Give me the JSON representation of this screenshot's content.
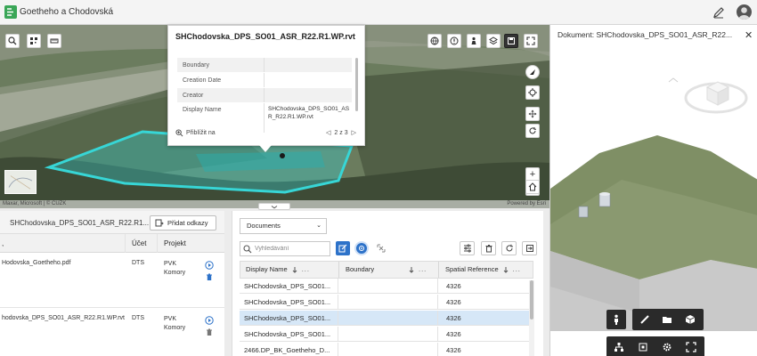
{
  "header": {
    "title": "Goetheho a Chodovská",
    "logo_icon": "app-logo-icon",
    "edit_icon": "pencil-icon",
    "avatar_icon": "user-avatar-icon"
  },
  "map": {
    "attribution_left": "Maxar, Microsoft | © ČÚZK",
    "attribution_right": "Powered by Esri",
    "left_tools": [
      "search-icon",
      "qr-code-icon",
      "measure-icon"
    ],
    "top_tools": [
      "globe-icon",
      "alert-icon",
      "person-icon",
      "layers-icon",
      "save-icon",
      "fullscreen-icon"
    ],
    "right_tools": [
      "compass-icon",
      "crosshair-icon",
      "pan-icon",
      "rotate-icon",
      "zoom-in-icon",
      "zoom-out-icon",
      "home-icon"
    ],
    "polygon_color": "#37d6d6"
  },
  "popup": {
    "title": "SHChodovska_DPS_SO01_ASR_R22.R1.WP.rvt",
    "rows": [
      {
        "key": "Boundary",
        "value": ""
      },
      {
        "key": "Creation Date",
        "value": ""
      },
      {
        "key": "Creator",
        "value": ""
      },
      {
        "key": "Display Name",
        "value": "SHChodovska_DPS_SO01_ASR_R22.R1.WP.rvt"
      }
    ],
    "zoom_label": "Přiblížit na",
    "pager": "2 z 3"
  },
  "document_panel": {
    "title": "Dokument: SHChodovska_DPS_SO01_ASR_R22...",
    "close_label": "✕",
    "tools": [
      "person-icon",
      "ruler-icon",
      "folder-icon",
      "cube-icon",
      "hierarchy-icon",
      "fit-icon",
      "settings-icon",
      "fullscreen-icon"
    ]
  },
  "attachments": {
    "filename": "SHChodovska_DPS_SO01_ASR_R22.R1...",
    "add_links_label": "Přidat odkazy",
    "columns": {
      "account": "Účet",
      "project": "Projekt"
    },
    "rows": [
      {
        "name": "Hodovska_Goetheho.pdf",
        "account": "DTS",
        "project_line1": "PVK",
        "project_line2": "Komory"
      },
      {
        "name": "hodovska_DPS_SO01_ASR_R22.R1.WP.rvt",
        "account": "DTS",
        "project_line1": "PVK",
        "project_line2": "Komory"
      }
    ]
  },
  "documents": {
    "select_value": "Documents",
    "search_placeholder": "Vyhledávání",
    "columns": {
      "display_name": "Display Name",
      "boundary": "Boundary",
      "spatial_reference": "Spatial Reference"
    },
    "more_label": "...",
    "rows": [
      {
        "display_name": "SHChodovska_DPS_SO01...",
        "boundary": "",
        "spatial_reference": "4326",
        "selected": false
      },
      {
        "display_name": "SHChodovska_DPS_SO01...",
        "boundary": "",
        "spatial_reference": "4326",
        "selected": false
      },
      {
        "display_name": "SHChodovska_DPS_SO01...",
        "boundary": "",
        "spatial_reference": "4326",
        "selected": true
      },
      {
        "display_name": "SHChodovska_DPS_SO01...",
        "boundary": "",
        "spatial_reference": "4326",
        "selected": false
      },
      {
        "display_name": "2466.DP_BK_Goetheho_D...",
        "boundary": "",
        "spatial_reference": "4326",
        "selected": false
      }
    ]
  }
}
